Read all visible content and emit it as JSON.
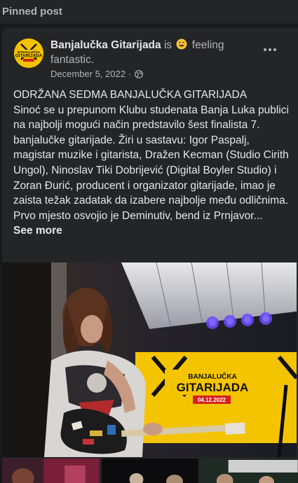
{
  "section": {
    "label": "Pinned post"
  },
  "post": {
    "author": "Banjalučka Gitarijada",
    "feeling_prefix": "is",
    "feeling_icon": "smiling-face-emoji",
    "feeling_text": "feeling fantastic.",
    "date": "December 5, 2022",
    "separator": "·",
    "audience_icon": "globe-icon",
    "body_lines": [
      "ODRŽANA SEDMA BANJALUČKA GITARIJADA",
      "Sinoć se u prepunom Klubu studenata Banja Luka publici na najbolji mogući način predstavilo šest finalista 7. banjalučke gitarijade. Žiri u sastavu: Igor Paspalj, magistar muzike i gitarista, Dražen Kecman (Studio Cirith Ungol), Ninoslav Tiki Dobrijević (Digital Boyler Studio) i Zoran Đurić, producent i organizator gitarijade, imao je zaista težak zadatak da izabere najbolje među odličnima.",
      "Prvo mjesto osvojio je Deminutiv, bend iz Prnjavor..."
    ],
    "see_more": "See more",
    "banner_text": {
      "top": "BANJALUČKA",
      "main": "GITARIJADA",
      "date": "04.12.2022"
    },
    "logo_text": {
      "top": "BANJALUČKA",
      "main": "GITARIJADA"
    }
  },
  "colors": {
    "background": "#18191a",
    "card": "#242526",
    "text_primary": "#e4e6eb",
    "text_secondary": "#b0b3b8",
    "brand_yellow": "#f5c200"
  }
}
